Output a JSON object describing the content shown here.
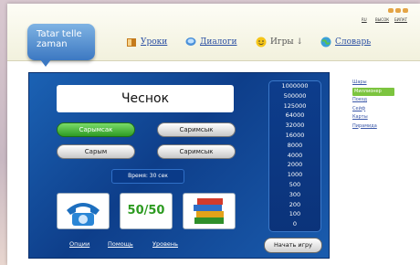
{
  "logo": {
    "line1": "Tatar telle",
    "line2": "zaman"
  },
  "nav": {
    "lessons": "Уроки",
    "dialogs": "Диалоги",
    "games": "Игры ↓",
    "dictionary": "Словарь"
  },
  "languages": [
    "RU",
    "ВЫСОК",
    "БИЛАТ"
  ],
  "game": {
    "word": "Чеснок",
    "answers": [
      {
        "label": "Сарымсак",
        "state": "correct"
      },
      {
        "label": "Саримсык",
        "state": "normal"
      },
      {
        "label": "Сарым",
        "state": "normal"
      },
      {
        "label": "Саримсык",
        "state": "normal"
      }
    ],
    "timer": "Время: 30 сек",
    "lifelines": [
      "phone-icon",
      "fifty-fifty",
      "books-icon"
    ],
    "fifty_label": "50/50",
    "prize_scale": [
      "1000000",
      "500000",
      "125000",
      "64000",
      "32000",
      "16000",
      "8000",
      "4000",
      "2000",
      "1000",
      "500",
      "300",
      "200",
      "100",
      "0"
    ],
    "footer_links": [
      "Опции",
      "Помощь",
      "Уровень"
    ],
    "start_button": "Начать игру"
  },
  "sidebar": {
    "items": [
      {
        "label": "Шары",
        "active": false
      },
      {
        "label": "Миллионер",
        "active": true
      },
      {
        "label": "Поезд",
        "active": false
      },
      {
        "label": "Сейф",
        "active": false
      },
      {
        "label": "Карты",
        "active": false
      },
      {
        "label": "Пирамида",
        "active": false
      }
    ]
  },
  "colors": {
    "accent_green": "#7cc43f",
    "game_blue": "#1b62b4",
    "link_blue": "#2b4fa3"
  }
}
